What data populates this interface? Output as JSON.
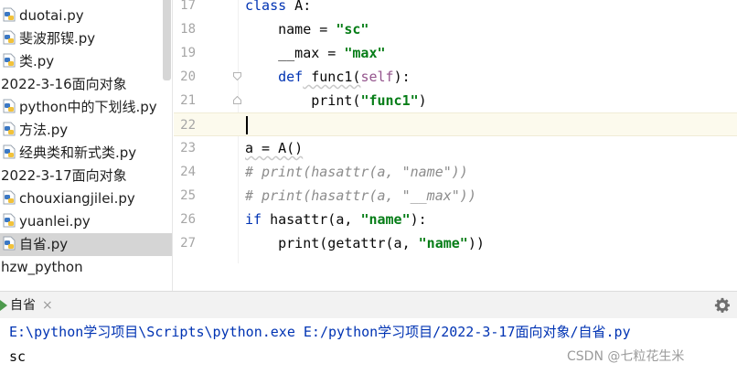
{
  "project_tree": {
    "items": [
      {
        "type": "file",
        "label": "duotai.py"
      },
      {
        "type": "file",
        "label": "斐波那锲.py"
      },
      {
        "type": "file",
        "label": "类.py"
      },
      {
        "type": "folder",
        "label": "2022-3-16面向对象"
      },
      {
        "type": "file",
        "label": "python中的下划线.py"
      },
      {
        "type": "file",
        "label": "方法.py"
      },
      {
        "type": "file",
        "label": "经典类和新式类.py"
      },
      {
        "type": "folder",
        "label": "2022-3-17面向对象"
      },
      {
        "type": "file",
        "label": "chouxiangjilei.py"
      },
      {
        "type": "file",
        "label": "yuanlei.py"
      },
      {
        "type": "file",
        "label": "自省.py",
        "selected": true
      },
      {
        "type": "folder",
        "label": "hzw_python"
      }
    ]
  },
  "editor": {
    "lines": [
      {
        "num": "17",
        "tokens": [
          [
            "kw",
            "class"
          ],
          [
            "plain",
            " A:"
          ]
        ]
      },
      {
        "num": "18",
        "tokens": [
          [
            "plain",
            "    name = "
          ],
          [
            "str",
            "\"sc\""
          ]
        ]
      },
      {
        "num": "19",
        "tokens": [
          [
            "plain",
            "    __max = "
          ],
          [
            "str",
            "\"max\""
          ]
        ]
      },
      {
        "num": "20",
        "tokens": [
          [
            "plain",
            "    "
          ],
          [
            "kw",
            "def"
          ],
          [
            "plain",
            " func1("
          ],
          [
            "self",
            "self"
          ],
          [
            "plain",
            "):"
          ]
        ]
      },
      {
        "num": "21",
        "tokens": [
          [
            "plain",
            "        print("
          ],
          [
            "str",
            "\"func1\""
          ],
          [
            "plain",
            ")"
          ]
        ]
      },
      {
        "num": "22",
        "tokens": []
      },
      {
        "num": "23",
        "tokens": [
          [
            "plain",
            "a = A()"
          ]
        ]
      },
      {
        "num": "24",
        "tokens": [
          [
            "cmt",
            "# print(hasattr(a, \"name\"))"
          ]
        ]
      },
      {
        "num": "25",
        "tokens": [
          [
            "cmt",
            "# print(hasattr(a, \"__max\"))"
          ]
        ]
      },
      {
        "num": "26",
        "tokens": [
          [
            "kw",
            "if"
          ],
          [
            "plain",
            " hasattr(a, "
          ],
          [
            "str",
            "\"name\""
          ],
          [
            "plain",
            "):"
          ]
        ]
      },
      {
        "num": "27",
        "tokens": [
          [
            "plain",
            "    print(getattr(a, "
          ],
          [
            "str",
            "\"name\""
          ],
          [
            "plain",
            "))"
          ]
        ]
      }
    ]
  },
  "run_panel": {
    "tab_label": "自省",
    "close_glyph": "×",
    "command": "E:\\python学习项目\\Scripts\\python.exe E:/python学习项目/2022-3-17面向对象/自省.py",
    "output": "sc"
  },
  "watermark": "CSDN @七粒花生米",
  "colors": {
    "keyword": "#0033b3",
    "string": "#067d17",
    "self": "#94558d",
    "comment": "#8c8c8c",
    "python_icon_blue": "#3b78c4",
    "python_icon_yellow": "#f2c23a"
  }
}
